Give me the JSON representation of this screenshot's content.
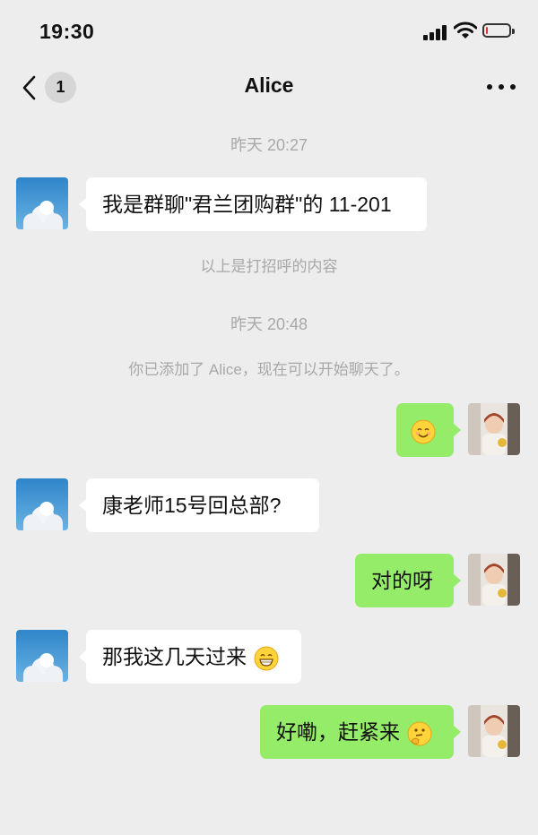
{
  "status_bar": {
    "time": "19:30",
    "battery_level": 0.1
  },
  "nav": {
    "unread_count": "1",
    "title": "Alice"
  },
  "icons": {
    "back": "chevron-left-icon",
    "more": "more-dots-icon",
    "signal": "cellular-signal-icon",
    "wifi": "wifi-icon",
    "battery": "battery-icon"
  },
  "colors": {
    "background": "#ededed",
    "outgoing_bubble": "#95ec69",
    "incoming_bubble": "#ffffff",
    "system_text": "#a8a8a8",
    "battery_low": "#e5322d"
  },
  "chat": {
    "time_1": "昨天 20:27",
    "msg_1": "我是群聊\"君兰团购群\"的 11-201",
    "sys_1": "以上是打招呼的内容",
    "time_2": "昨天 20:48",
    "sys_2": "你已添加了 Alice，现在可以开始聊天了。",
    "msg_2_emoji": "smiling-face-emoji",
    "msg_3": "康老师15号回总部?",
    "msg_4": "对的呀",
    "msg_5": "那我这几天过来",
    "msg_5_emoji": "grinning-face-emoji",
    "msg_6": "好嘞，赶紧来",
    "msg_6_emoji": "thinking-face-emoji"
  }
}
